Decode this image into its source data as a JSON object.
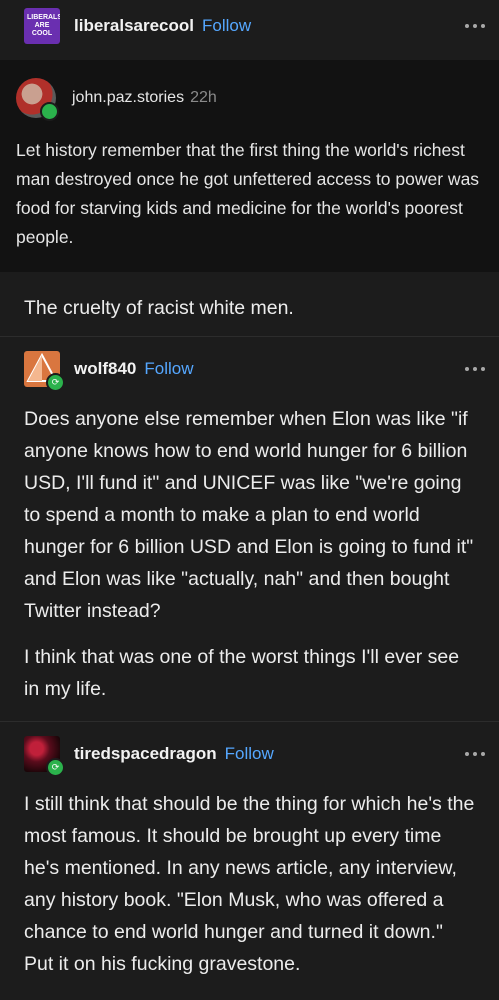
{
  "header": {
    "logo_text": "LIBERALS ARE COOL",
    "blog_name": "liberalsarecool",
    "follow_label": "Follow"
  },
  "quoted_post": {
    "username": "john.paz.stories",
    "time": "22h",
    "text": "Let history remember that the first thing the world's richest man destroyed once he got unfettered access to power was food for starving kids and medicine for the world's poorest people."
  },
  "reblog_comment": "The cruelty of racist white men.",
  "replies": [
    {
      "username": "wolf840",
      "follow_label": "Follow",
      "paragraphs": [
        "Does anyone else remember when Elon was like \"if anyone knows how to end world hunger for 6 billion USD, I'll fund it\" and UNICEF was like \"we're going to spend a month to make a plan to end world hunger for 6 billion USD and Elon is going to fund it\" and Elon was like \"actually, nah\" and then bought Twitter instead?",
        "I think that was one of the worst things I'll ever see in my life."
      ]
    },
    {
      "username": "tiredspacedragon",
      "follow_label": "Follow",
      "paragraphs": [
        "I still think that should be the thing for which he's the most famous. It should be brought up every time he's mentioned. In any news article, any interview, any history book. \"Elon Musk, who was offered a chance to end world hunger and turned it down.\" Put it on his fucking gravestone."
      ]
    }
  ],
  "icons": {
    "more": "more-options-icon",
    "reblog": "reblog-badge-icon"
  },
  "colors": {
    "accent": "#55a7ff",
    "badge": "#2bb24c",
    "background": "#1c1c1c"
  }
}
